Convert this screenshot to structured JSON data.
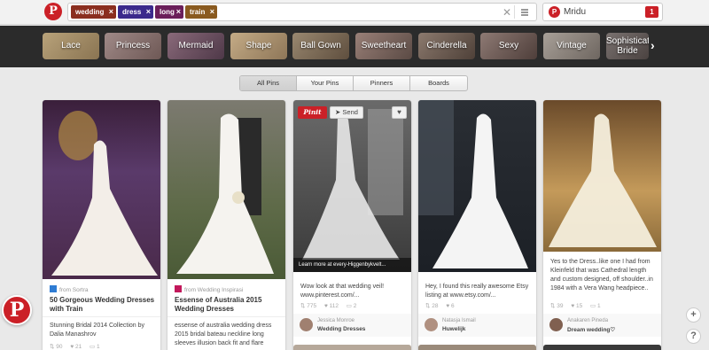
{
  "header": {
    "logo_glyph": "P",
    "search_tokens": [
      {
        "label": "wedding",
        "color": "#8b2e1f"
      },
      {
        "label": "dress",
        "color": "#3b2a8c"
      },
      {
        "label": "long",
        "color": "#6b1f5a"
      },
      {
        "label": "train",
        "color": "#8a5a1f"
      }
    ],
    "token_close": "×",
    "clear_glyph": "✕",
    "user_name": "Mridu",
    "notification_count": "1"
  },
  "categories": [
    "Lace",
    "Princess",
    "Mermaid",
    "Shape",
    "Ball Gown",
    "Sweetheart",
    "Cinderella",
    "Sexy",
    "Vintage",
    "Sophisticated Bride"
  ],
  "category_next": "›",
  "tabs": [
    "All Pins",
    "Your Pins",
    "Pinners",
    "Boards"
  ],
  "pins": [
    {
      "source": "from Sortra",
      "title": "50 Gorgeous Wedding Dresses with Train",
      "description": "Stunning Bridal 2014 Collection by Dalia Manashrov",
      "repins": "90",
      "likes": "21",
      "comments": "1"
    },
    {
      "source": "from Wedding Inspirasi",
      "title": "Essense of Australia 2015 Wedding Dresses",
      "description": "essense of australia wedding dress 2015 bridal bateau neckline long sleeves illusion back fit and flare"
    },
    {
      "pinit_label": "Pinit",
      "send_label": "Send",
      "learn_more": "Learn more at every-Higgenbykvelt...",
      "description": "Wow look at that wedding veil! www.pinterest.com/...",
      "repins": "775",
      "likes": "112",
      "comments": "2",
      "pinner_name": "Jessica Monroe",
      "board": "Wedding Dresses"
    },
    {
      "description": "Hey, I found this really awesome Etsy listing at www.etsy.com/...",
      "repins": "28",
      "likes": "6",
      "pinner_name": "Natasja Ismail",
      "board": "Huwelijk"
    },
    {
      "description": "Yes to the Dress..like one I had from Kleinfeld that was Cathedral length and custom designed, off shoulder..in 1984 with a Vera Wang headpiece..",
      "repins": "39",
      "likes": "15",
      "comments": "1",
      "pinner_name": "Anakaren Pineda",
      "board": "Dream wedding♡"
    }
  ],
  "fab": {
    "plus": "+",
    "help": "?"
  }
}
